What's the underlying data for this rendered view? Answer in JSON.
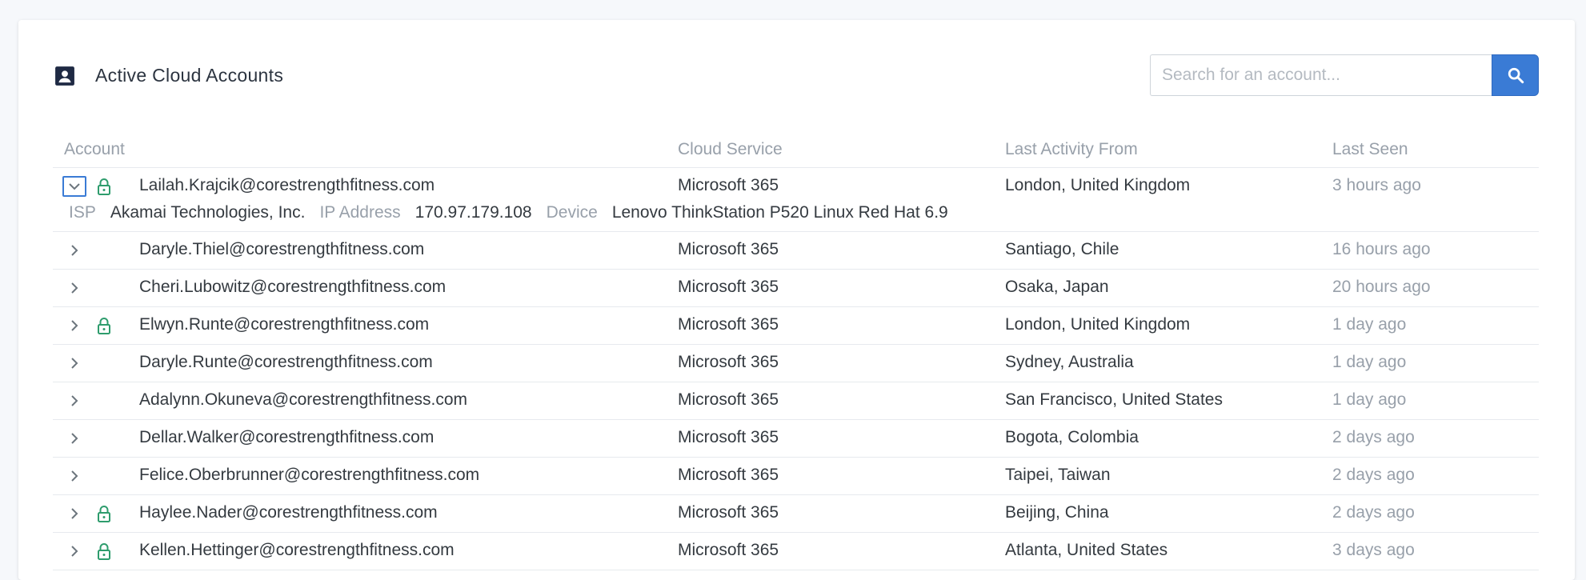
{
  "header": {
    "title": "Active Cloud Accounts",
    "title_icon": "account-box-icon",
    "search_placeholder": "Search for an account...",
    "search_icon": "search-icon"
  },
  "colors": {
    "accent": "#3a7bd5",
    "lock": "#2e9c6d",
    "muted": "#98a0aa",
    "text": "#343a40"
  },
  "table": {
    "columns": [
      "Account",
      "Cloud Service",
      "Last Activity From",
      "Last Seen"
    ],
    "rows": [
      {
        "account": "Lailah.Krajcik@corestrengthfitness.com",
        "service": "Microsoft 365",
        "location": "London, United Kingdom",
        "seen": "3 hours ago",
        "locked": true,
        "expanded": true
      },
      {
        "account": "Daryle.Thiel@corestrengthfitness.com",
        "service": "Microsoft 365",
        "location": "Santiago, Chile",
        "seen": "16 hours ago",
        "locked": false
      },
      {
        "account": "Cheri.Lubowitz@corestrengthfitness.com",
        "service": "Microsoft 365",
        "location": "Osaka, Japan",
        "seen": "20 hours ago",
        "locked": false
      },
      {
        "account": "Elwyn.Runte@corestrengthfitness.com",
        "service": "Microsoft 365",
        "location": "London, United Kingdom",
        "seen": "1 day ago",
        "locked": true
      },
      {
        "account": "Daryle.Runte@corestrengthfitness.com",
        "service": "Microsoft 365",
        "location": "Sydney, Australia",
        "seen": "1 day ago",
        "locked": false
      },
      {
        "account": "Adalynn.Okuneva@corestrengthfitness.com",
        "service": "Microsoft 365",
        "location": "San Francisco, United States",
        "seen": "1 day ago",
        "locked": false
      },
      {
        "account": "Dellar.Walker@corestrengthfitness.com",
        "service": "Microsoft 365",
        "location": "Bogota, Colombia",
        "seen": "2 days ago",
        "locked": false
      },
      {
        "account": "Felice.Oberbrunner@corestrengthfitness.com",
        "service": "Microsoft 365",
        "location": "Taipei, Taiwan",
        "seen": "2 days ago",
        "locked": false
      },
      {
        "account": "Haylee.Nader@corestrengthfitness.com",
        "service": "Microsoft 365",
        "location": "Beijing, China",
        "seen": "2 days ago",
        "locked": true
      },
      {
        "account": "Kellen.Hettinger@corestrengthfitness.com",
        "service": "Microsoft 365",
        "location": "Atlanta, United States",
        "seen": "3 days ago",
        "locked": true
      }
    ],
    "detail": {
      "isp_label": "ISP",
      "isp": "Akamai Technologies, Inc.",
      "ip_label": "IP Address",
      "ip": "170.97.179.108",
      "device_label": "Device",
      "device": "Lenovo ThinkStation P520 Linux Red Hat 6.9"
    }
  }
}
